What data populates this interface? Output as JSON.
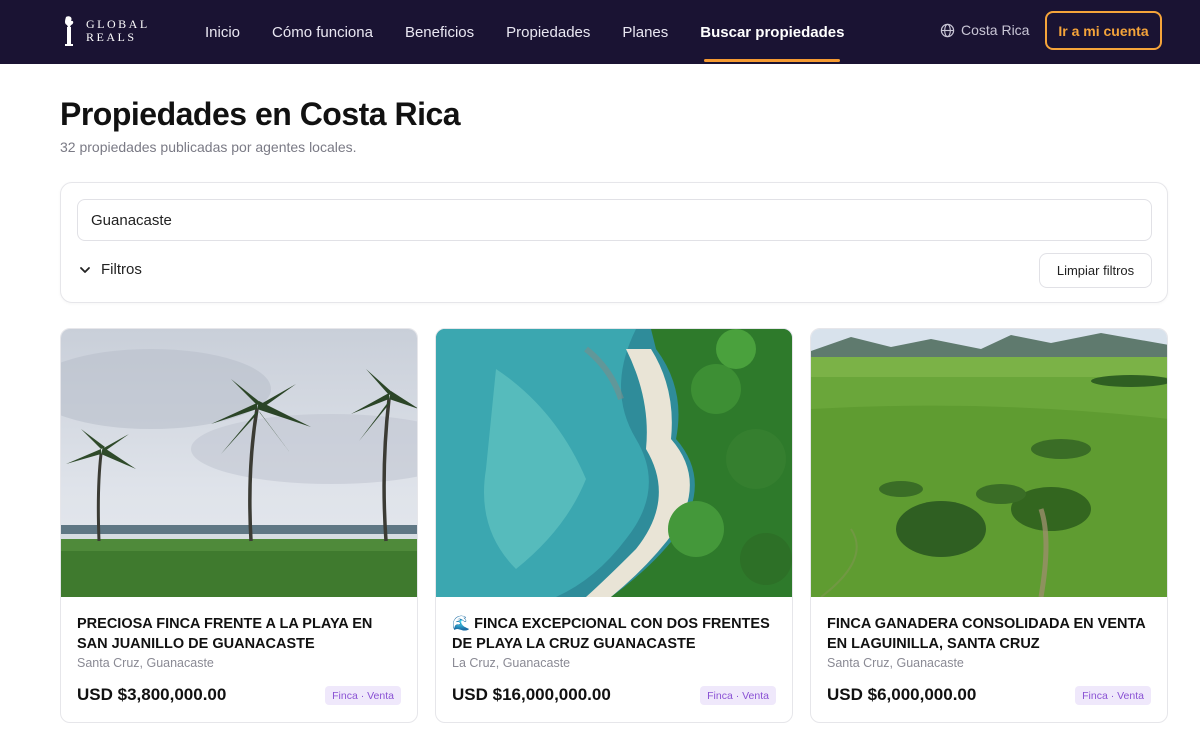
{
  "header": {
    "logo": {
      "line1": "GLOBAL",
      "line2": "REALS"
    },
    "nav": [
      {
        "label": "Inicio"
      },
      {
        "label": "Cómo funciona"
      },
      {
        "label": "Beneficios"
      },
      {
        "label": "Propiedades"
      },
      {
        "label": "Planes"
      },
      {
        "label": "Buscar propiedades",
        "active": true
      }
    ],
    "country": "Costa Rica",
    "account_button": "Ir a mi cuenta"
  },
  "page": {
    "title": "Propiedades en Costa Rica",
    "subtitle": "32 propiedades publicadas por agentes locales."
  },
  "search": {
    "value": "Guanacaste",
    "filters_label": "Filtros",
    "clear_label": "Limpiar filtros"
  },
  "listings": [
    {
      "title": "PRECIOSA FINCA FRENTE A LA PLAYA EN SAN JUANILLO DE GUANACASTE",
      "location": "Santa Cruz, Guanacaste",
      "price": "USD $3,800,000.00",
      "badge": "Finca · Venta",
      "image": "beach-palm-trees-photo"
    },
    {
      "title": "🌊 FINCA EXCEPCIONAL CON DOS FRENTES DE PLAYA LA CRUZ GUANACASTE",
      "location": "La Cruz, Guanacaste",
      "price": "USD $16,000,000.00",
      "badge": "Finca · Venta",
      "image": "aerial-coast-forest-photo"
    },
    {
      "title": "FINCA GANADERA CONSOLIDADA EN VENTA EN LAGUINILLA, SANTA CRUZ",
      "location": "Santa Cruz, Guanacaste",
      "price": "USD $6,000,000.00",
      "badge": "Finca · Venta",
      "image": "green-pasture-mountains-photo"
    }
  ],
  "colors": {
    "header_bg": "#1a1333",
    "accent": "#f5a43a",
    "badge_bg": "#efe8fb",
    "badge_text": "#8a52d4"
  }
}
